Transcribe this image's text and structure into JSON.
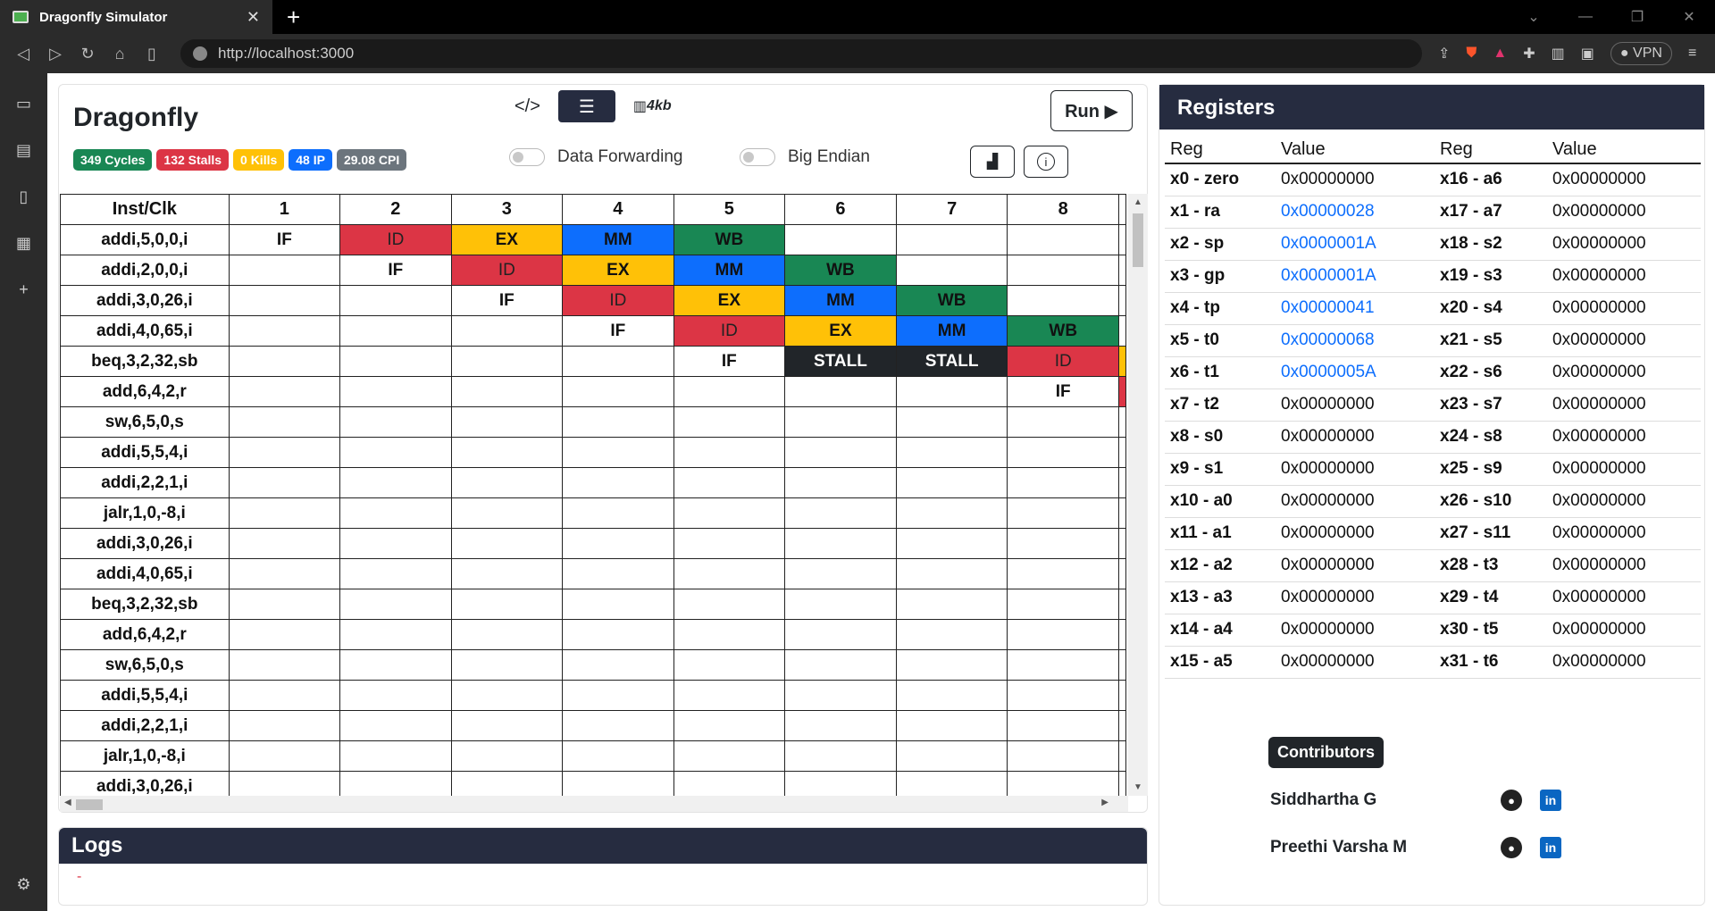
{
  "browser": {
    "tab_title": "Dragonfly Simulator",
    "tab_close": "✕",
    "new_tab": "+",
    "url": "http://localhost:3000",
    "vpn": "● VPN"
  },
  "app": {
    "brand": "Dragonfly",
    "memory_label": "4kb",
    "run_label": "Run ▶",
    "badges": {
      "cycles": "349 Cycles",
      "stalls": "132 Stalls",
      "kills": "0 Kills",
      "ip": "48 IP",
      "cpi": "29.08 CPI"
    },
    "toggles": {
      "forwarding": "Data Forwarding",
      "endian": "Big Endian"
    }
  },
  "pipeline": {
    "header": [
      "Inst/Clk",
      "1",
      "2",
      "3",
      "4",
      "5",
      "6",
      "7",
      "8"
    ],
    "rows": [
      {
        "inst": "addi,5,0,0,i",
        "stages": [
          "IF",
          "ID",
          "EX",
          "MM",
          "WB",
          "",
          "",
          ""
        ]
      },
      {
        "inst": "addi,2,0,0,i",
        "stages": [
          "",
          "IF",
          "ID",
          "EX",
          "MM",
          "WB",
          "",
          ""
        ]
      },
      {
        "inst": "addi,3,0,26,i",
        "stages": [
          "",
          "",
          "IF",
          "ID",
          "EX",
          "MM",
          "WB",
          ""
        ]
      },
      {
        "inst": "addi,4,0,65,i",
        "stages": [
          "",
          "",
          "",
          "IF",
          "ID",
          "EX",
          "MM",
          "WB"
        ]
      },
      {
        "inst": "beq,3,2,32,sb",
        "stages": [
          "",
          "",
          "",
          "",
          "IF",
          "STALL",
          "STALL",
          "ID"
        ]
      },
      {
        "inst": "add,6,4,2,r",
        "stages": [
          "",
          "",
          "",
          "",
          "",
          "",
          "",
          "IF"
        ]
      },
      {
        "inst": "sw,6,5,0,s",
        "stages": [
          "",
          "",
          "",
          "",
          "",
          "",
          "",
          ""
        ]
      },
      {
        "inst": "addi,5,5,4,i",
        "stages": [
          "",
          "",
          "",
          "",
          "",
          "",
          "",
          ""
        ]
      },
      {
        "inst": "addi,2,2,1,i",
        "stages": [
          "",
          "",
          "",
          "",
          "",
          "",
          "",
          ""
        ]
      },
      {
        "inst": "jalr,1,0,-8,i",
        "stages": [
          "",
          "",
          "",
          "",
          "",
          "",
          "",
          ""
        ]
      },
      {
        "inst": "addi,3,0,26,i",
        "stages": [
          "",
          "",
          "",
          "",
          "",
          "",
          "",
          ""
        ]
      },
      {
        "inst": "addi,4,0,65,i",
        "stages": [
          "",
          "",
          "",
          "",
          "",
          "",
          "",
          ""
        ]
      },
      {
        "inst": "beq,3,2,32,sb",
        "stages": [
          "",
          "",
          "",
          "",
          "",
          "",
          "",
          ""
        ]
      },
      {
        "inst": "add,6,4,2,r",
        "stages": [
          "",
          "",
          "",
          "",
          "",
          "",
          "",
          ""
        ]
      },
      {
        "inst": "sw,6,5,0,s",
        "stages": [
          "",
          "",
          "",
          "",
          "",
          "",
          "",
          ""
        ]
      },
      {
        "inst": "addi,5,5,4,i",
        "stages": [
          "",
          "",
          "",
          "",
          "",
          "",
          "",
          ""
        ]
      },
      {
        "inst": "addi,2,2,1,i",
        "stages": [
          "",
          "",
          "",
          "",
          "",
          "",
          "",
          ""
        ]
      },
      {
        "inst": "jalr,1,0,-8,i",
        "stages": [
          "",
          "",
          "",
          "",
          "",
          "",
          "",
          ""
        ]
      },
      {
        "inst": "addi,3,0,26,i",
        "stages": [
          "",
          "",
          "",
          "",
          "",
          "",
          "",
          ""
        ]
      }
    ],
    "edge_colors": [
      "",
      "",
      "",
      "",
      "#ffc107",
      "#dc3545",
      "",
      "",
      "",
      "",
      "",
      "",
      "",
      "",
      "",
      "",
      "",
      "",
      ""
    ]
  },
  "logs": {
    "title": "Logs",
    "text": "-"
  },
  "registers": {
    "title": "Registers",
    "headers": [
      "Reg",
      "Value",
      "Reg",
      "Value"
    ],
    "rows": [
      {
        "r1": "x0 - zero",
        "v1": "0x00000000",
        "h1": false,
        "r2": "x16 - a6",
        "v2": "0x00000000"
      },
      {
        "r1": "x1 - ra",
        "v1": "0x00000028",
        "h1": true,
        "r2": "x17 - a7",
        "v2": "0x00000000"
      },
      {
        "r1": "x2 - sp",
        "v1": "0x0000001A",
        "h1": true,
        "r2": "x18 - s2",
        "v2": "0x00000000"
      },
      {
        "r1": "x3 - gp",
        "v1": "0x0000001A",
        "h1": true,
        "r2": "x19 - s3",
        "v2": "0x00000000"
      },
      {
        "r1": "x4 - tp",
        "v1": "0x00000041",
        "h1": true,
        "r2": "x20 - s4",
        "v2": "0x00000000"
      },
      {
        "r1": "x5 - t0",
        "v1": "0x00000068",
        "h1": true,
        "r2": "x21 - s5",
        "v2": "0x00000000"
      },
      {
        "r1": "x6 - t1",
        "v1": "0x0000005A",
        "h1": true,
        "r2": "x22 - s6",
        "v2": "0x00000000"
      },
      {
        "r1": "x7 - t2",
        "v1": "0x00000000",
        "h1": false,
        "r2": "x23 - s7",
        "v2": "0x00000000"
      },
      {
        "r1": "x8 - s0",
        "v1": "0x00000000",
        "h1": false,
        "r2": "x24 - s8",
        "v2": "0x00000000"
      },
      {
        "r1": "x9 - s1",
        "v1": "0x00000000",
        "h1": false,
        "r2": "x25 - s9",
        "v2": "0x00000000"
      },
      {
        "r1": "x10 - a0",
        "v1": "0x00000000",
        "h1": false,
        "r2": "x26 - s10",
        "v2": "0x00000000"
      },
      {
        "r1": "x11 - a1",
        "v1": "0x00000000",
        "h1": false,
        "r2": "x27 - s11",
        "v2": "0x00000000"
      },
      {
        "r1": "x12 - a2",
        "v1": "0x00000000",
        "h1": false,
        "r2": "x28 - t3",
        "v2": "0x00000000"
      },
      {
        "r1": "x13 - a3",
        "v1": "0x00000000",
        "h1": false,
        "r2": "x29 - t4",
        "v2": "0x00000000"
      },
      {
        "r1": "x14 - a4",
        "v1": "0x00000000",
        "h1": false,
        "r2": "x30 - t5",
        "v2": "0x00000000"
      },
      {
        "r1": "x15 - a5",
        "v1": "0x00000000",
        "h1": false,
        "r2": "x31 - t6",
        "v2": "0x00000000"
      }
    ]
  },
  "contributors": {
    "title": "Contributors",
    "people": [
      "Siddhartha G",
      "Preethi Varsha M"
    ]
  },
  "colors": {
    "IF": "#ffffff",
    "ID": "#dc3545",
    "EX": "#ffc107",
    "MM": "#0d6efd",
    "WB": "#198754",
    "STALL": "#212529",
    "header_bg": "#262c40"
  },
  "icons": {
    "code": "code-icon",
    "pipeline": "pipeline-icon",
    "memory": "memory-icon",
    "chart": "bar-chart-icon",
    "info": "info-icon",
    "github": "github-icon",
    "linkedin": "linkedin-icon"
  }
}
